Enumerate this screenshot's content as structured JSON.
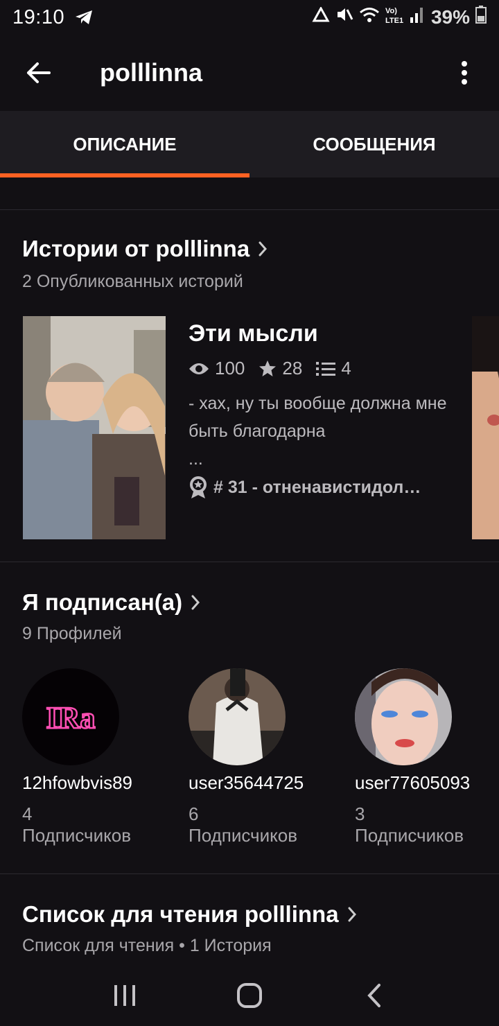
{
  "status": {
    "time": "19:10",
    "battery": "39%"
  },
  "app_bar": {
    "title": "polllinna"
  },
  "tabs": [
    {
      "label": "ОПИСАНИЕ",
      "active": true
    },
    {
      "label": "СООБЩЕНИЯ",
      "active": false
    }
  ],
  "stories": {
    "title": "Истории от polllinna",
    "subtitle": "2 Опубликованных историй",
    "items": [
      {
        "title": "Эти мысли",
        "views": "100",
        "votes": "28",
        "parts": "4",
        "description": "- хах, ну ты вообще должна мне быть благодарна",
        "ellipsis": "...",
        "rank": "# 31 - отненавистидол…"
      }
    ]
  },
  "following": {
    "title": "Я подписан(а)",
    "subtitle": "9 Профилей",
    "profiles": [
      {
        "name": "12hfowbvis89",
        "count": "4",
        "label": "Подписчиков"
      },
      {
        "name": "user35644725",
        "count": "6",
        "label": "Подписчиков"
      },
      {
        "name": "user77605093",
        "count": "3",
        "label": "Подписчиков"
      }
    ]
  },
  "reading_list": {
    "title": "Список для чтения polllinna",
    "subtitle": "Список для чтения • 1 История"
  },
  "colors": {
    "accent": "#ff6122",
    "background": "#121014",
    "tab_bg": "#1e1c21"
  }
}
